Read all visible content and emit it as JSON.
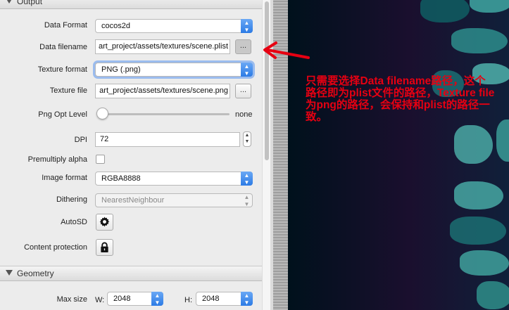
{
  "output_section": {
    "title": "Output",
    "data_format": {
      "label": "Data Format",
      "value": "cocos2d"
    },
    "data_filename": {
      "label": "Data filename",
      "value": "art_project/assets/textures/scene.plist",
      "button": "..."
    },
    "texture_format": {
      "label": "Texture format",
      "value": "PNG (.png)"
    },
    "texture_file": {
      "label": "Texture file",
      "value": "art_project/assets/textures/scene.png",
      "button": "..."
    },
    "png_opt_level": {
      "label": "Png Opt Level",
      "value_text": "none",
      "level": 0
    },
    "dpi": {
      "label": "DPI",
      "value": "72"
    },
    "premultiply_alpha": {
      "label": "Premultiply alpha",
      "checked": false
    },
    "image_format": {
      "label": "Image format",
      "value": "RGBA8888"
    },
    "dithering": {
      "label": "Dithering",
      "value": "NearestNeighbour"
    },
    "autosd": {
      "label": "AutoSD",
      "icon": "gear-icon"
    },
    "content_protection": {
      "label": "Content protection",
      "icon": "lock-icon"
    }
  },
  "geometry_section": {
    "title": "Geometry",
    "max_size": {
      "label": "Max size",
      "w_label": "W:",
      "w_value": "2048",
      "h_label": "H:",
      "h_value": "2048"
    }
  },
  "annotation": {
    "text": "只需要选择Data filename路径，这个路径即为plist文件的路径，Texture file为png的路径，会保持和plist的路径一致。",
    "color": "#e60012"
  },
  "colors": {
    "accent": "#2c7be5",
    "annotation_red": "#e60012"
  }
}
